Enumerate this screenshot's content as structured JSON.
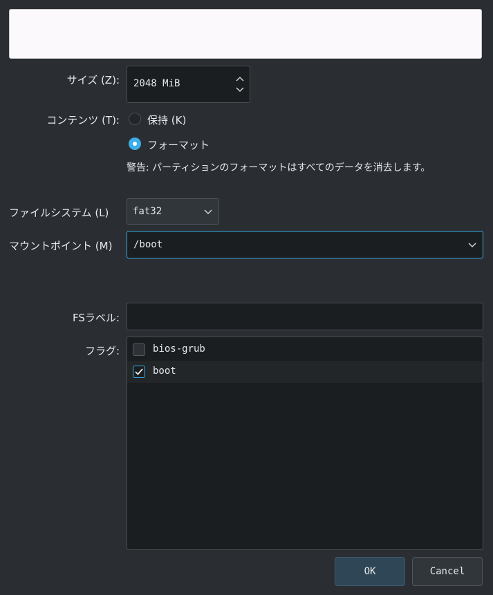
{
  "size": {
    "label": "サイズ (Z):",
    "value": "2048 MiB"
  },
  "contents": {
    "label": "コンテンツ (T):",
    "options": [
      {
        "label": "保持 (K)",
        "selected": false
      },
      {
        "label": "フォーマット",
        "selected": true
      }
    ],
    "warning": "警告: パーティションのフォーマットはすべてのデータを消去します。"
  },
  "filesystem": {
    "label": "ファイルシステム (L)",
    "value": "fat32"
  },
  "mountpoint": {
    "label": "マウントポイント (M)",
    "value": "/boot"
  },
  "fslabel": {
    "label": "FSラベル:",
    "value": ""
  },
  "flags": {
    "label": "フラグ:",
    "items": [
      {
        "label": "bios-grub",
        "checked": false
      },
      {
        "label": "boot",
        "checked": true
      }
    ]
  },
  "buttons": {
    "ok": "OK",
    "cancel": "Cancel"
  },
  "colors": {
    "accent": "#3daee9",
    "background": "#2a2e32",
    "field": "#1b1e20"
  }
}
